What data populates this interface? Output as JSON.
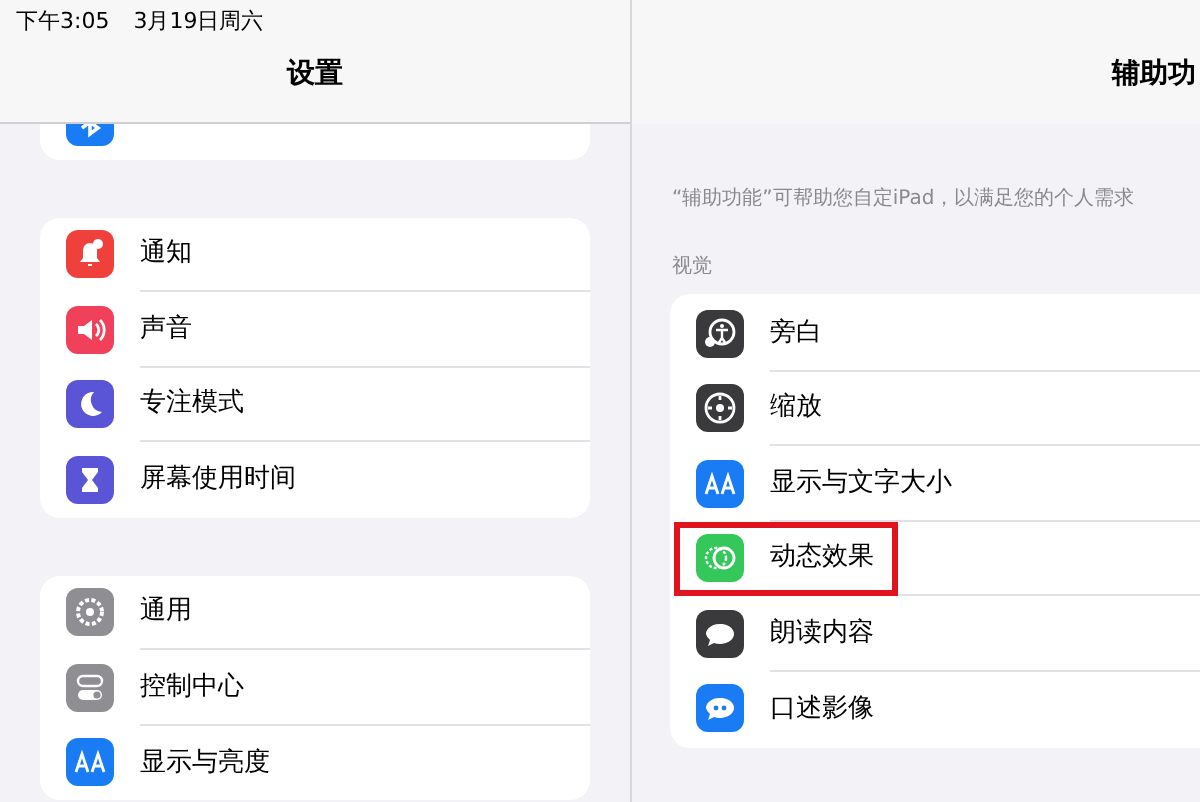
{
  "status_bar": {
    "time": "下午3:05",
    "date": "3月19日周六"
  },
  "sidebar": {
    "title": "设置",
    "groups": [
      [
        {
          "kind": "bluetooth"
        }
      ],
      [
        {
          "label": "通知",
          "kind": "bell"
        },
        {
          "label": "声音",
          "kind": "speaker"
        },
        {
          "label": "专注模式",
          "kind": "moon"
        },
        {
          "label": "屏幕使用时间",
          "kind": "hourglass"
        }
      ],
      [
        {
          "label": "通用",
          "kind": "gear"
        },
        {
          "label": "控制中心",
          "kind": "toggles"
        },
        {
          "label": "显示与亮度",
          "kind": "aa"
        }
      ]
    ]
  },
  "detail": {
    "title": "辅助功",
    "description": "“辅助功能”可帮助您自定iPad，以满足您的个人需求",
    "section": "视觉",
    "items": [
      {
        "label": "旁白",
        "kind": "voiceover",
        "highlighted": false
      },
      {
        "label": "缩放",
        "kind": "zoom",
        "highlighted": false
      },
      {
        "label": "显示与文字大小",
        "kind": "aa",
        "highlighted": false
      },
      {
        "label": "动态效果",
        "kind": "motion",
        "highlighted": true
      },
      {
        "label": "朗读内容",
        "kind": "speech",
        "highlighted": false
      },
      {
        "label": "口述影像",
        "kind": "bubble",
        "highlighted": false
      }
    ]
  }
}
